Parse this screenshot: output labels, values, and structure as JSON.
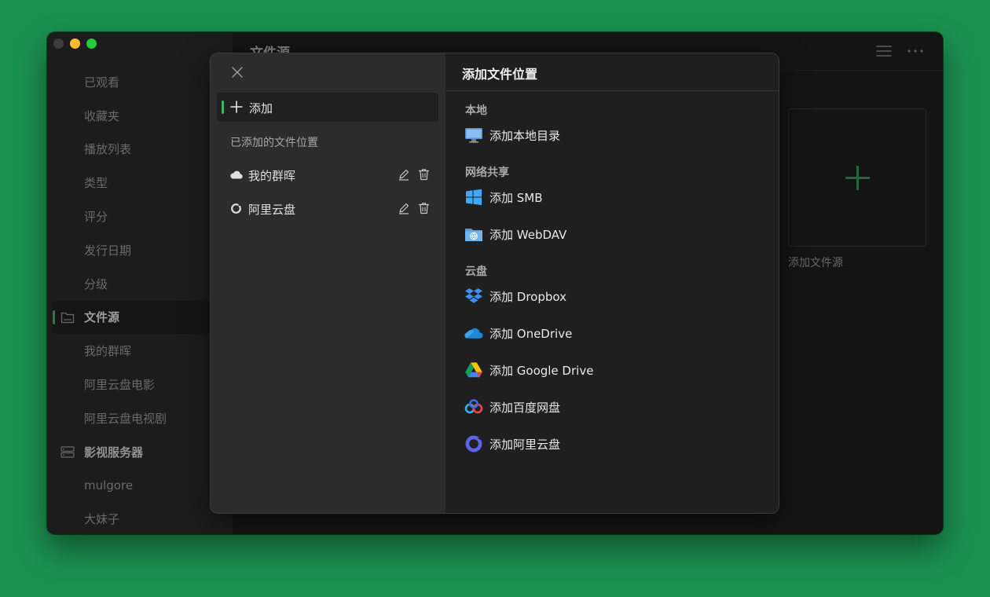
{
  "sidebar": {
    "items": [
      {
        "label": "已观看"
      },
      {
        "label": "收藏夹"
      },
      {
        "label": "播放列表"
      },
      {
        "label": "类型"
      },
      {
        "label": "评分"
      },
      {
        "label": "发行日期"
      },
      {
        "label": "分级"
      },
      {
        "label": "文件源"
      },
      {
        "label": "我的群晖"
      },
      {
        "label": "阿里云盘电影"
      },
      {
        "label": "阿里云盘电视剧"
      },
      {
        "label": "影视服务器"
      },
      {
        "label": "mulgore"
      },
      {
        "label": "大妹子"
      }
    ]
  },
  "main": {
    "title": "文件源",
    "add_source_label": "添加文件源"
  },
  "modal": {
    "add_label": "添加",
    "added_section_title": "已添加的文件位置",
    "added_locations": [
      {
        "name": "我的群晖",
        "icon": "cloud-icon"
      },
      {
        "name": "阿里云盘",
        "icon": "aliyun-icon"
      }
    ],
    "right_title": "添加文件位置",
    "groups": [
      {
        "title": "本地",
        "options": [
          {
            "label": "添加本地目录",
            "icon": "monitor-icon"
          }
        ]
      },
      {
        "title": "网络共享",
        "options": [
          {
            "label": "添加 SMB",
            "icon": "windows-icon"
          },
          {
            "label": "添加 WebDAV",
            "icon": "webdav-folder-icon"
          }
        ]
      },
      {
        "title": "云盘",
        "options": [
          {
            "label": "添加 Dropbox",
            "icon": "dropbox-icon"
          },
          {
            "label": "添加 OneDrive",
            "icon": "onedrive-icon"
          },
          {
            "label": "添加 Google Drive",
            "icon": "google-drive-icon"
          },
          {
            "label": "添加百度网盘",
            "icon": "baidu-netdisk-icon"
          },
          {
            "label": "添加阿里云盘",
            "icon": "aliyun-drive-icon"
          }
        ]
      }
    ]
  },
  "colors": {
    "accent": "#3bb36a",
    "desktop": "#1b9150"
  }
}
